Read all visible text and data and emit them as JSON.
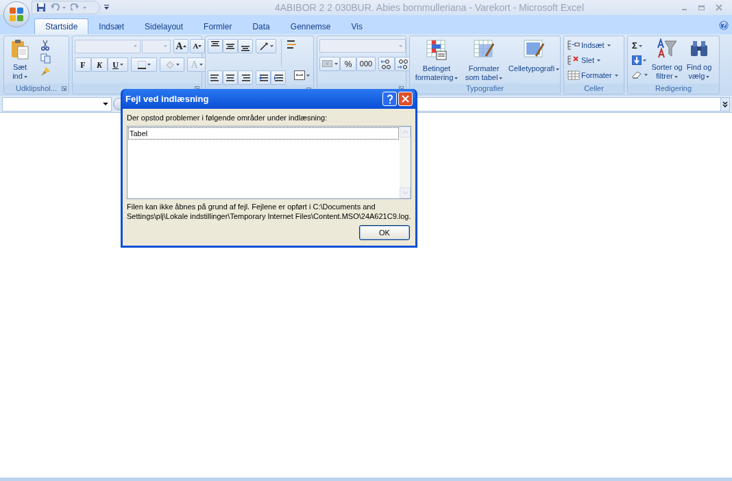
{
  "window": {
    "title": "4ABIBOR 2 2 030BUR. Abies bornmulleriana - Varekort - Microsoft Excel"
  },
  "tabs": [
    {
      "label": "Startside",
      "selected": true
    },
    {
      "label": "Indsæt",
      "selected": false
    },
    {
      "label": "Sidelayout",
      "selected": false
    },
    {
      "label": "Formler",
      "selected": false
    },
    {
      "label": "Data",
      "selected": false
    },
    {
      "label": "Gennemse",
      "selected": false
    },
    {
      "label": "Vis",
      "selected": false
    }
  ],
  "ribbon": {
    "groups": [
      {
        "label": "Udklipshol...",
        "dialog_launcher": true,
        "buttons": [
          "Sæt ind"
        ]
      },
      {
        "dialog_launcher": true,
        "glyphs": [
          "A",
          "A",
          "F",
          "K",
          "U",
          "A"
        ]
      },
      {
        "dialog_launcher": true
      },
      {
        "dialog_launcher": true,
        "glyphs": [
          "%",
          "000"
        ]
      },
      {
        "label": "Typografier",
        "buttons": [
          "Betinget formatering",
          "Formater som tabel",
          "Celletypografi"
        ]
      },
      {
        "label": "Celler",
        "buttons": [
          "Indsæt",
          "Slet",
          "Formater"
        ]
      },
      {
        "label": "Redigering",
        "glyphs": [
          "Σ"
        ],
        "buttons": [
          "Sorter og filtrer",
          "Find og vælg"
        ]
      }
    ]
  },
  "dialog": {
    "title": "Fejl ved indlæsning",
    "message": "Der opstod problemer i følgende områder under indlæsning:",
    "list": [
      {
        "label": "Tabel",
        "selected": true
      }
    ],
    "details": "Filen kan ikke åbnes på grund af fejl. Fejlene er opført i C:\\Documents and Settings\\plj\\Lokale indstillinger\\Temporary Internet Files\\Content.MSO\\24A621C9.log.",
    "buttons": [
      "OK"
    ]
  }
}
